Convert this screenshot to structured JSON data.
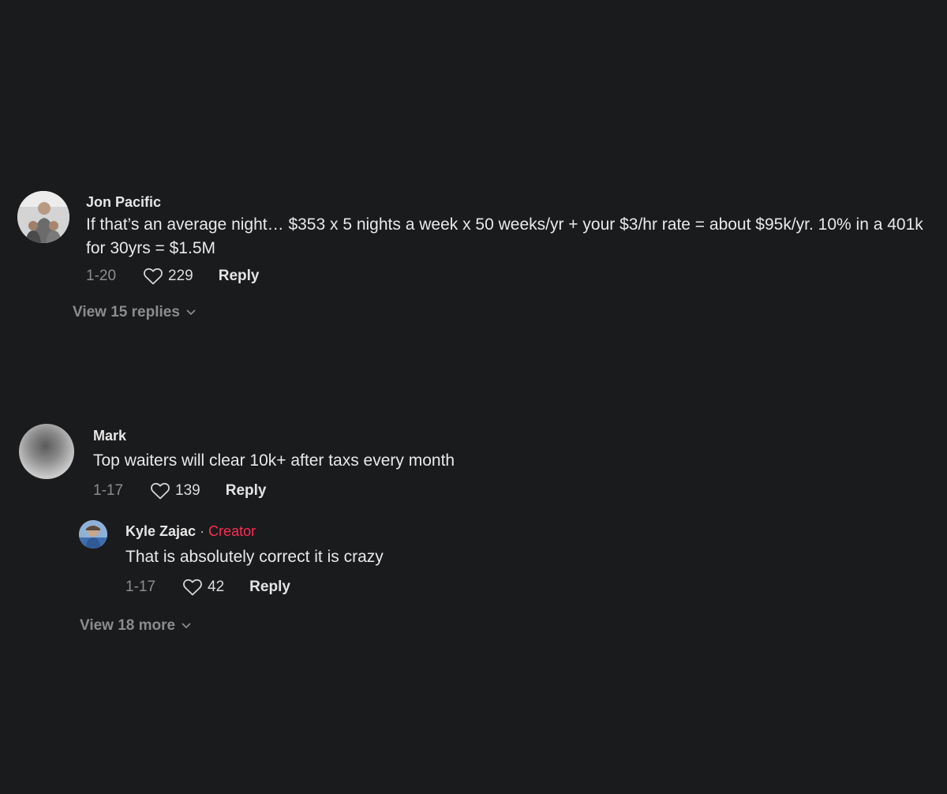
{
  "comments": [
    {
      "author": "Jon Pacific",
      "text": "If that’s an average night… $353 x 5 nights a week x 50 weeks/yr + your $3/hr rate = about $95k/yr. 10% in a 401k for 30yrs = $1.5M",
      "date": "1-20",
      "likes": "229",
      "reply_label": "Reply",
      "view_replies_label": "View 15 replies"
    },
    {
      "author": "Mark",
      "text": "Top waiters will clear 10k+ after taxs every month",
      "date": "1-17",
      "likes": "139",
      "reply_label": "Reply",
      "replies": [
        {
          "author": "Kyle Zajac",
          "separator": " · ",
          "badge": "Creator",
          "text": "That is absolutely correct it is crazy",
          "date": "1-17",
          "likes": "42",
          "reply_label": "Reply"
        }
      ],
      "view_more_label": "View 18 more"
    }
  ],
  "colors": {
    "background": "#1a1b1d",
    "creator_badge": "#fe2c55"
  }
}
